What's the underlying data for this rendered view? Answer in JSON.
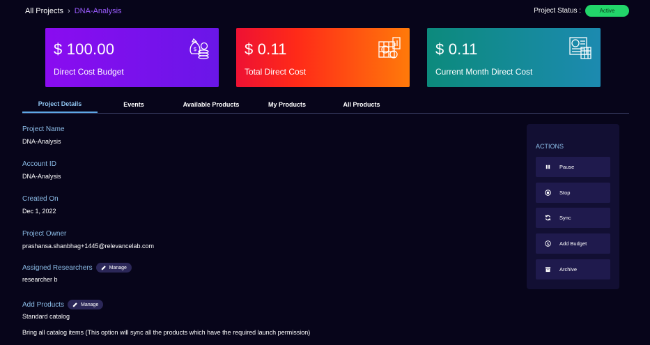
{
  "breadcrumb": {
    "root": "All Projects",
    "separator": "›",
    "current": "DNA-Analysis"
  },
  "status": {
    "label": "Project Status :",
    "value": "Active"
  },
  "cards": {
    "budget": {
      "amount": "$ 100.00",
      "label": "Direct Cost Budget",
      "icon": "money-bag-icon"
    },
    "total": {
      "amount": "$ 0.11",
      "label": "Total Direct Cost",
      "icon": "cost-chart-icon"
    },
    "month": {
      "amount": "$ 0.11",
      "label": "Current Month Direct Cost",
      "icon": "calendar-cost-icon"
    }
  },
  "tabs": [
    {
      "label": "Project Details",
      "active": true
    },
    {
      "label": "Events"
    },
    {
      "label": "Available Products"
    },
    {
      "label": "My Products"
    },
    {
      "label": "All Products"
    }
  ],
  "details": {
    "project_name": {
      "label": "Project Name",
      "value": "DNA-Analysis"
    },
    "account_id": {
      "label": "Account ID",
      "value": "DNA-Analysis"
    },
    "created_on": {
      "label": "Created On",
      "value": "Dec 1, 2022"
    },
    "owner": {
      "label": "Project Owner",
      "value": "prashansa.shanbhag+1445@relevancelab.com"
    },
    "researchers": {
      "label": "Assigned Researchers",
      "manage": "Manage",
      "value": "researcher b"
    },
    "products": {
      "label": "Add Products",
      "manage": "Manage",
      "value": "Standard catalog",
      "note": "Bring all catalog items (This option will sync all the products which have the required launch permission)"
    }
  },
  "actions": {
    "title": "ACTIONS",
    "pause": "Pause",
    "stop": "Stop",
    "sync": "Sync",
    "add_budget": "Add Budget",
    "archive": "Archive"
  },
  "colors": {
    "accent": "#9b5cff",
    "label": "#8cbde8",
    "active_status": "#22d66a"
  }
}
